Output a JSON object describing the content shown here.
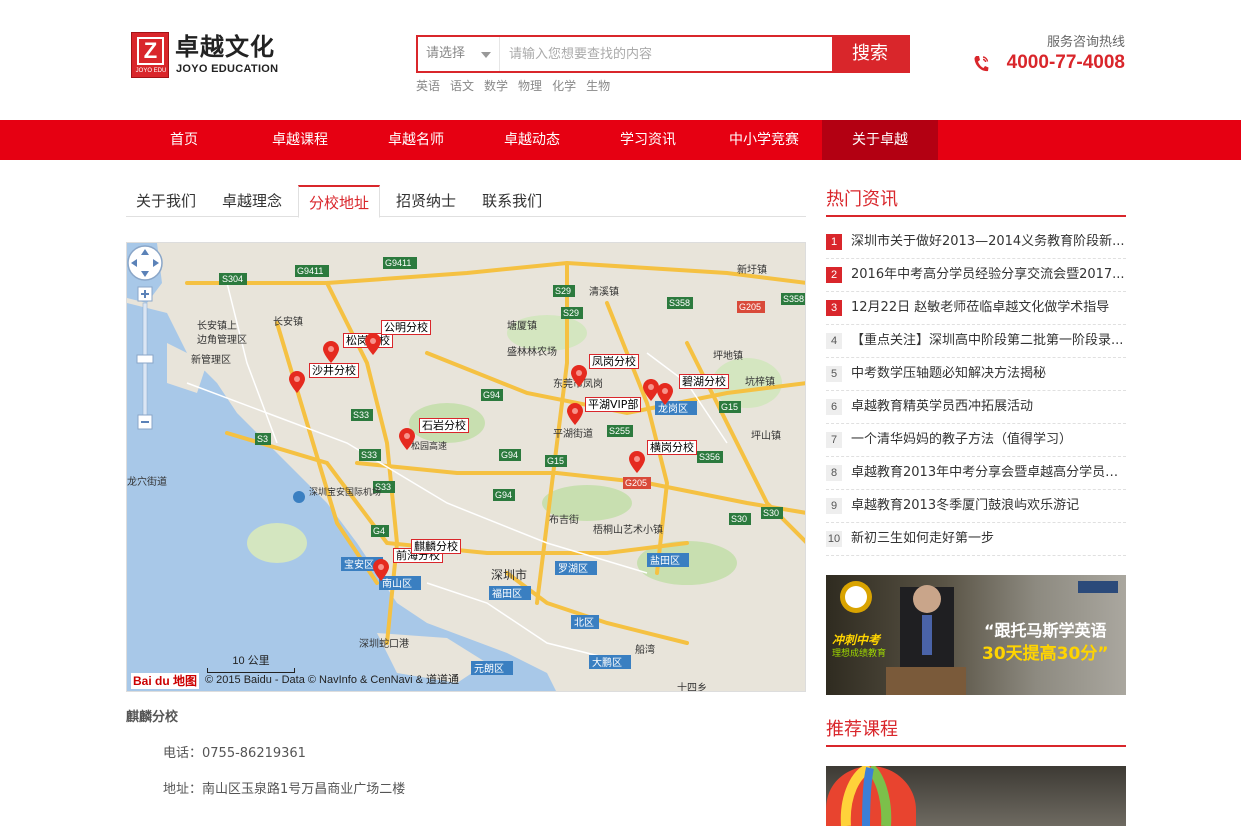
{
  "header": {
    "logo_cn": "卓越文化",
    "logo_en": "JOYO EDUCATION",
    "logo_mark": "Z",
    "logo_mark_sub": "JOYO EDU",
    "search": {
      "select_value": "请选择",
      "placeholder": "请输入您想要查找的内容",
      "button_label": "搜索"
    },
    "hot_words": [
      "英语",
      "语文",
      "数学",
      "物理",
      "化学",
      "生物"
    ],
    "hotline_label": "服务咨询热线",
    "hotline_number": "4000-77-4008"
  },
  "nav": {
    "items": [
      "首页",
      "卓越课程",
      "卓越名师",
      "卓越动态",
      "学习资讯",
      "中小学竞赛",
      "关于卓越"
    ],
    "active": "关于卓越"
  },
  "tabs": {
    "items": [
      "关于我们",
      "卓越理念",
      "分校地址",
      "招贤纳士",
      "联系我们"
    ],
    "active": "分校地址"
  },
  "map": {
    "places": [
      "沙井分校",
      "松岗分校",
      "公明分校",
      "石岩分校",
      "凤岗分校",
      "平湖VIP部",
      "碧湖分校",
      "横岗分校",
      "前海分校",
      "麒麟分校"
    ],
    "place_names": [
      "清溪镇",
      "塘厦镇",
      "盛林林农场",
      "东莞市凤岗",
      "平湖街道",
      "布吉街",
      "梧桐山艺术小镇",
      "深圳市",
      "罗湖区",
      "福田区",
      "南山区",
      "宝安区",
      "龙岗区",
      "坪地镇",
      "坑梓镇",
      "坪山镇",
      "新圩镇",
      "长安镇上",
      "边角管理区",
      "新管理区",
      "长安镇",
      "龙穴街道",
      "深圳宝安国际机场",
      "深圳蛇口港",
      "盐田区",
      "大鹏区",
      "北区",
      "元朗区",
      "船湾",
      "十四乡",
      "松园高速"
    ],
    "roads": [
      "S304",
      "G9411",
      "S29",
      "S358",
      "G205",
      "S33",
      "S3",
      "G94",
      "G15",
      "S255",
      "S356",
      "S30",
      "G4"
    ],
    "scale_label": "10 公里",
    "baidu_logo": "Bai du 地图",
    "copyright": "© 2015 Baidu - Data © NavInfo & CenNavi & 道道通"
  },
  "branch": {
    "name": "麒麟分校",
    "phone": "电话：0755-86219361",
    "address": "地址：南山区玉泉路1号万昌商业广场二楼"
  },
  "sidebar": {
    "hot_news_title": "热门资讯",
    "news": [
      "深圳市关于做好2013—2014义务教育阶段新...",
      "2016年中考高分学员经验分享交流会暨2017...",
      "12月22日 赵敏老师莅临卓越文化做学术指导",
      "【重点关注】深圳高中阶段第二批第一阶段录...",
      "中考数学压轴题必知解决方法揭秘",
      "卓越教育精英学员西冲拓展活动",
      "一个清华妈妈的教子方法（值得学习）",
      "卓越教育2013年中考分享会暨卓越高分学员颁...",
      "卓越教育2013冬季厦门鼓浪屿欢乐游记",
      "新初三生如何走好第一步"
    ],
    "ad": {
      "headline1": "“跟托马斯学英语",
      "headline2": "30天提高30分”",
      "left1": "冲刺中考",
      "left2": "理想成绩教育"
    },
    "recommend_title": "推荐课程"
  },
  "colors": {
    "brand_red": "#d9262b",
    "nav_red": "#e60012",
    "nav_active": "#b30012"
  }
}
